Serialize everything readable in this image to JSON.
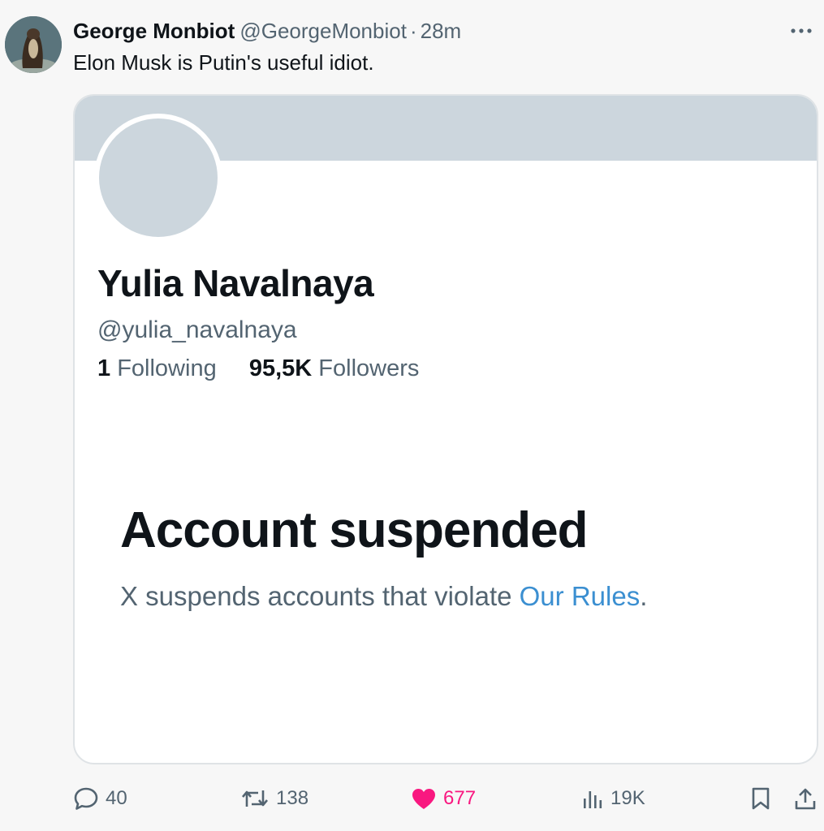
{
  "tweet": {
    "author_name": "George Monbiot",
    "author_handle": "@GeorgeMonbiot",
    "separator": "·",
    "time_ago": "28m",
    "text": "Elon Musk is Putin's useful idiot.",
    "more_icon": "more-horizontal-icon"
  },
  "card": {
    "profile_name": "Yulia Navalnaya",
    "profile_handle": "@yulia_navalnaya",
    "following_count": "1",
    "following_label": "Following",
    "followers_count": "95,5K",
    "followers_label": "Followers",
    "suspended_title": "Account suspended",
    "suspended_text": "X suspends accounts that violate ",
    "rules_link": "Our Rules",
    "suspended_end": "."
  },
  "actions": {
    "replies": "40",
    "reposts": "138",
    "likes": "677",
    "views": "19K"
  },
  "colors": {
    "like_active": "#f91880",
    "link": "#3b8fd1",
    "banner": "#ccd6dd"
  }
}
